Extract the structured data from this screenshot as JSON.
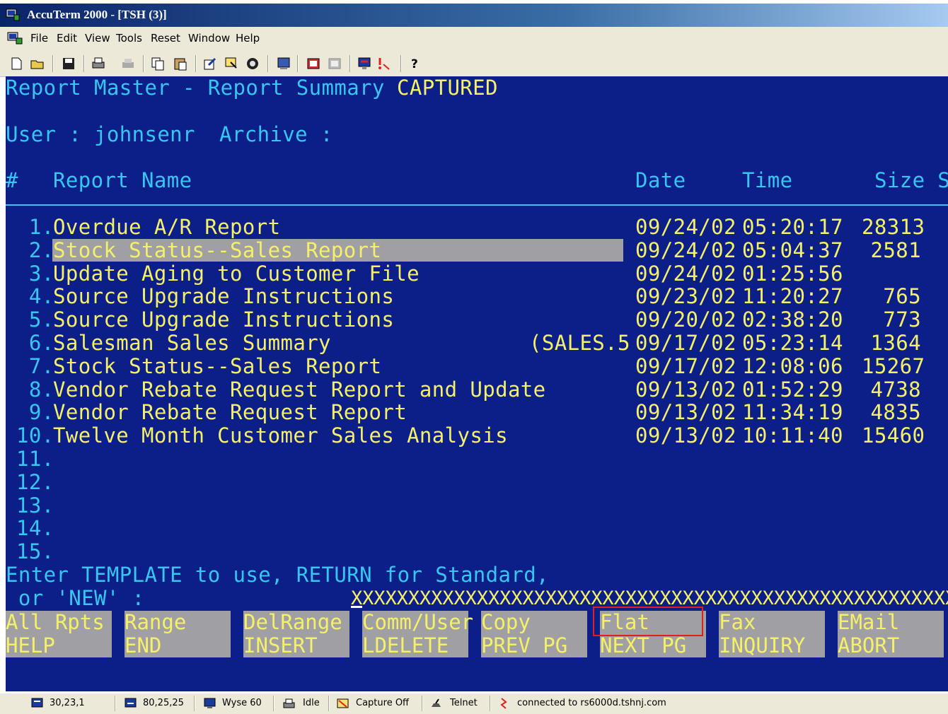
{
  "window": {
    "title": "AccuTerm 2000 - [TSH (3)]"
  },
  "menu": {
    "items": [
      "File",
      "Edit",
      "View",
      "Tools",
      "Reset",
      "Window",
      "Help"
    ]
  },
  "toolbar": {
    "icons": [
      "new-icon",
      "open-icon",
      "save-icon",
      "print-icon",
      "print-setup-icon",
      "copy-icon",
      "paste-icon",
      "edit-icon",
      "select-icon",
      "stop-icon",
      "connect-icon",
      "upload-icon",
      "download-icon",
      "script-icon",
      "disconnect-icon",
      "help-icon"
    ]
  },
  "terminal": {
    "header": {
      "title": "Report Master - Report Summary",
      "status": "CAPTURED"
    },
    "user_label": "User : johnsenr",
    "archive_label": "Archive :",
    "columns": {
      "num": "#",
      "name": "Report Name",
      "date": "Date",
      "time": "Time",
      "size": "Size S"
    },
    "rows": [
      {
        "num": " 1.",
        "name": "Overdue A/R Report",
        "extra": "",
        "date": "09/24/02",
        "time": "05:20:17",
        "size": "28313"
      },
      {
        "num": " 2.",
        "name": "Stock Status--Sales Report",
        "extra": "",
        "date": "09/24/02",
        "time": "05:04:37",
        "size": "2581"
      },
      {
        "num": " 3.",
        "name": "Update Aging to Customer File",
        "extra": "",
        "date": "09/24/02",
        "time": "01:25:56",
        "size": ""
      },
      {
        "num": " 4.",
        "name": "Source Upgrade Instructions",
        "extra": "",
        "date": "09/23/02",
        "time": "11:20:27",
        "size": "765"
      },
      {
        "num": " 5.",
        "name": "Source Upgrade Instructions",
        "extra": "",
        "date": "09/20/02",
        "time": "02:38:20",
        "size": "773"
      },
      {
        "num": " 6.",
        "name": "Salesman Sales Summary",
        "extra": "(SALES.5",
        "date": "09/17/02",
        "time": "05:23:14",
        "size": "1364"
      },
      {
        "num": " 7.",
        "name": "Stock Status--Sales Report",
        "extra": "",
        "date": "09/17/02",
        "time": "12:08:06",
        "size": "15267"
      },
      {
        "num": " 8.",
        "name": "Vendor Rebate Request Report and Update",
        "extra": "",
        "date": "09/13/02",
        "time": "01:52:29",
        "size": "4738"
      },
      {
        "num": " 9.",
        "name": "Vendor Rebate Request Report",
        "extra": "",
        "date": "09/13/02",
        "time": "11:34:19",
        "size": "4835"
      },
      {
        "num": "10.",
        "name": "Twelve Month Customer Sales Analysis",
        "extra": "",
        "date": "09/13/02",
        "time": "10:11:40",
        "size": "15460"
      },
      {
        "num": "11.",
        "name": "",
        "extra": "",
        "date": "",
        "time": "",
        "size": ""
      },
      {
        "num": "12.",
        "name": "",
        "extra": "",
        "date": "",
        "time": "",
        "size": ""
      },
      {
        "num": "13.",
        "name": "",
        "extra": "",
        "date": "",
        "time": "",
        "size": ""
      },
      {
        "num": "14.",
        "name": "",
        "extra": "",
        "date": "",
        "time": "",
        "size": ""
      },
      {
        "num": "15.",
        "name": "",
        "extra": "",
        "date": "",
        "time": "",
        "size": ""
      }
    ],
    "prompt_line1": "Enter TEMPLATE to use, RETURN for Standard,",
    "prompt_line2": " or 'NEW' :",
    "input_value": "XXXXXXXXXXXXXXXXXXXXXXXXXXXXXXXXXXXXXXXXXXXXXXXXXXXXXX",
    "function_keys": [
      {
        "top": "All Rpts",
        "bottom": "HELP"
      },
      {
        "top": "Range",
        "bottom": "END"
      },
      {
        "top": "DelRange",
        "bottom": "INSERT"
      },
      {
        "top": "Comm/User",
        "bottom": "LDELETE"
      },
      {
        "top": "Copy",
        "bottom": "PREV PG"
      },
      {
        "top": "Flat",
        "bottom": "NEXT PG"
      },
      {
        "top": "Fax",
        "bottom": "INQUIRY"
      },
      {
        "top": "EMail",
        "bottom": "ABORT"
      }
    ]
  },
  "statusbar": {
    "cursor_pos": "30,23,1",
    "screen_size": "80,25,25",
    "emulation": "Wyse 60",
    "print_state": "Idle",
    "capture": "Capture Off",
    "protocol": "Telnet",
    "connection": "connected to rs6000d.tshnj.com"
  },
  "colors": {
    "terminal_bg": "#0c1e88",
    "cyan_text": "#37c6f0",
    "yellow_text": "#f5f06a",
    "highlight": "#a0a0a4"
  }
}
